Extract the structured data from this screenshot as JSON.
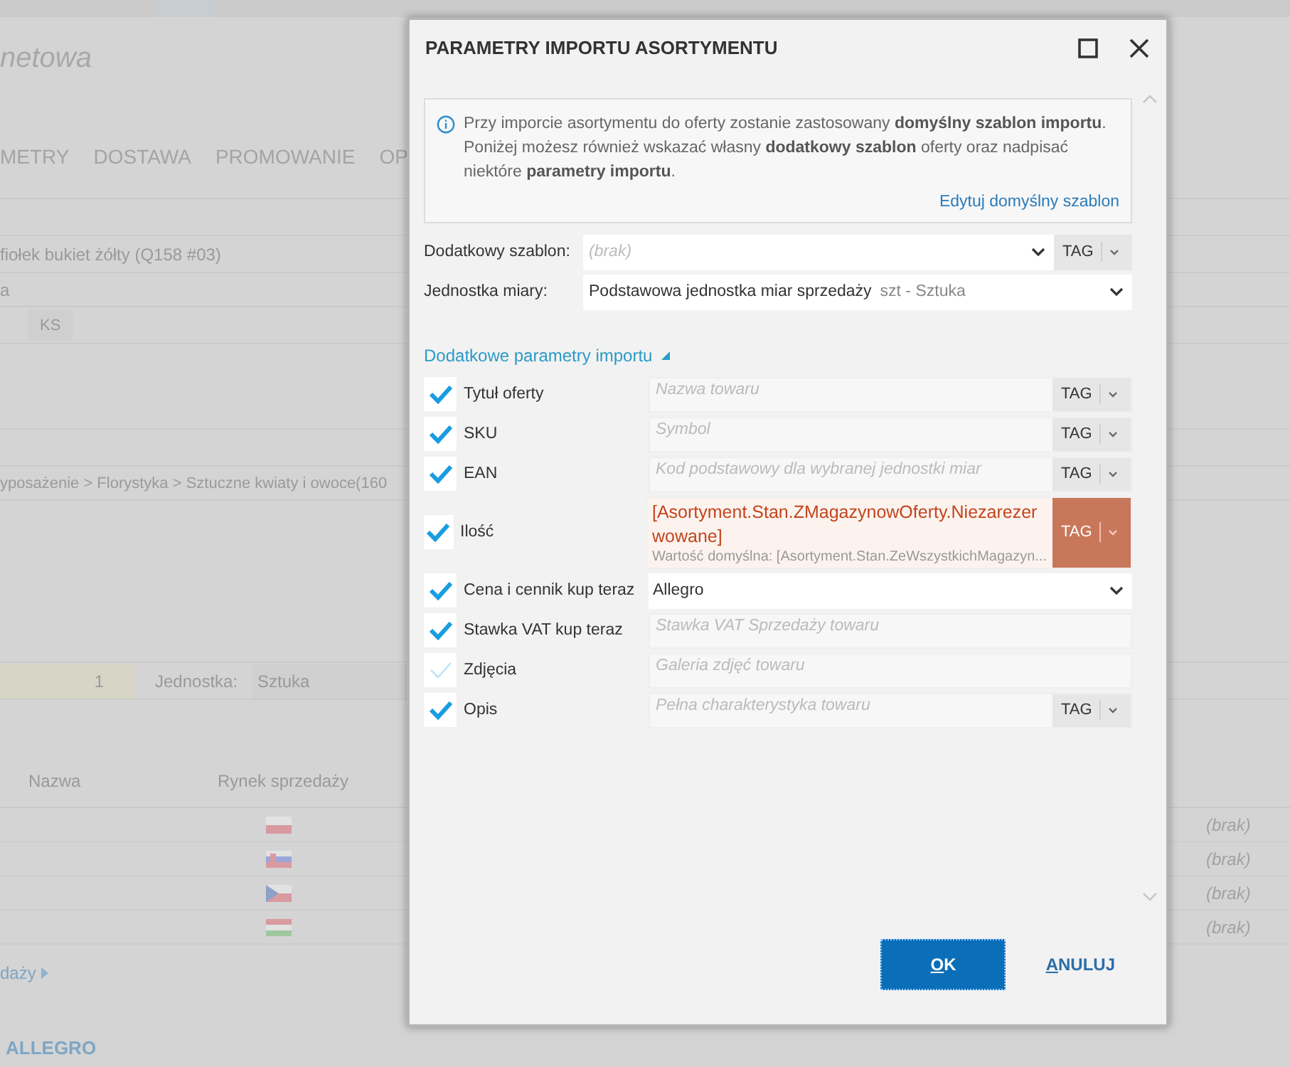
{
  "background": {
    "title": "netowa",
    "tabs": [
      "METRY",
      "DOSTAWA",
      "PROMOWANIE",
      "OP"
    ],
    "product_name": "fiołek bukiet żółty (Q158 #03)",
    "field_2": "a",
    "chip": "KS",
    "category": "yposażenie > Florystyka > Sztuczne kwiaty i owoce(160",
    "quantity": "1",
    "unit_label": "Jednostka:",
    "unit_value": "Sztuka",
    "table": {
      "columns": [
        "Nazwa",
        "Rynek sprzedaży"
      ],
      "rows": [
        {
          "kind": "pl",
          "value": "(brak)"
        },
        {
          "kind": "sk",
          "value": "(brak)"
        },
        {
          "kind": "cz",
          "value": "(brak)"
        },
        {
          "kind": "hu",
          "value": "(brak)"
        }
      ]
    },
    "link": "daży",
    "section": "ALLEGRO"
  },
  "dialog": {
    "title": "PARAMETRY IMPORTU ASORTYMENTU",
    "info": [
      "Przy imporcie asortymentu do oferty zostanie zastosowany **domyślny szablon importu**.",
      "Poniżej możesz również wskazać własny **dodatkowy szablon** oferty oraz nadpisać niektóre **parametry importu**."
    ],
    "info_link": "Edytuj domyślny szablon",
    "template": {
      "label": "Dodatkowy szablon:",
      "placeholder": "(brak)",
      "tag": "TAG"
    },
    "unit": {
      "label": "Jednostka miary:",
      "value": "Podstawowa jednostka miar sprzedaży",
      "hint": "szt - Sztuka"
    },
    "section": {
      "label": "Dodatkowe parametry importu",
      "expanded": true
    },
    "params": [
      {
        "label": "Tytuł oferty",
        "checked": true,
        "disabled": false,
        "kind": "tag",
        "placeholder": "Nazwa towaru",
        "tag": "TAG"
      },
      {
        "label": "SKU",
        "checked": true,
        "disabled": false,
        "kind": "tag",
        "placeholder": "Symbol",
        "tag": "TAG"
      },
      {
        "label": "EAN",
        "checked": true,
        "disabled": false,
        "kind": "tag",
        "placeholder": "Kod podstawowy dla wybranej jednostki miar",
        "tag": "TAG"
      },
      {
        "label": "Ilość",
        "checked": true,
        "disabled": false,
        "kind": "tag",
        "value": "[Asortyment.Stan.ZMagazynowOferty.Niezarezerwowane]",
        "hint": "Wartość domyślna: [Asortyment.Stan.ZeWszystkichMagazyn...",
        "tag": "TAG",
        "overridden": true
      },
      {
        "label": "Cena i cennik kup teraz",
        "checked": true,
        "disabled": false,
        "kind": "select",
        "value": "Allegro"
      },
      {
        "label": "Stawka VAT kup teraz",
        "checked": true,
        "disabled": false,
        "kind": "plain",
        "placeholder": "Stawka VAT Sprzedaży towaru"
      },
      {
        "label": "Zdjęcia",
        "checked": true,
        "disabled": true,
        "kind": "plain",
        "placeholder": "Galeria zdjęć towaru"
      },
      {
        "label": "Opis",
        "checked": true,
        "disabled": false,
        "kind": "tag",
        "placeholder": "Pełna charakterystyka towaru",
        "tag": "TAG"
      }
    ],
    "buttons": [
      {
        "label": "OK",
        "primary": true
      },
      {
        "label": "ANULUJ",
        "primary": false
      }
    ]
  }
}
